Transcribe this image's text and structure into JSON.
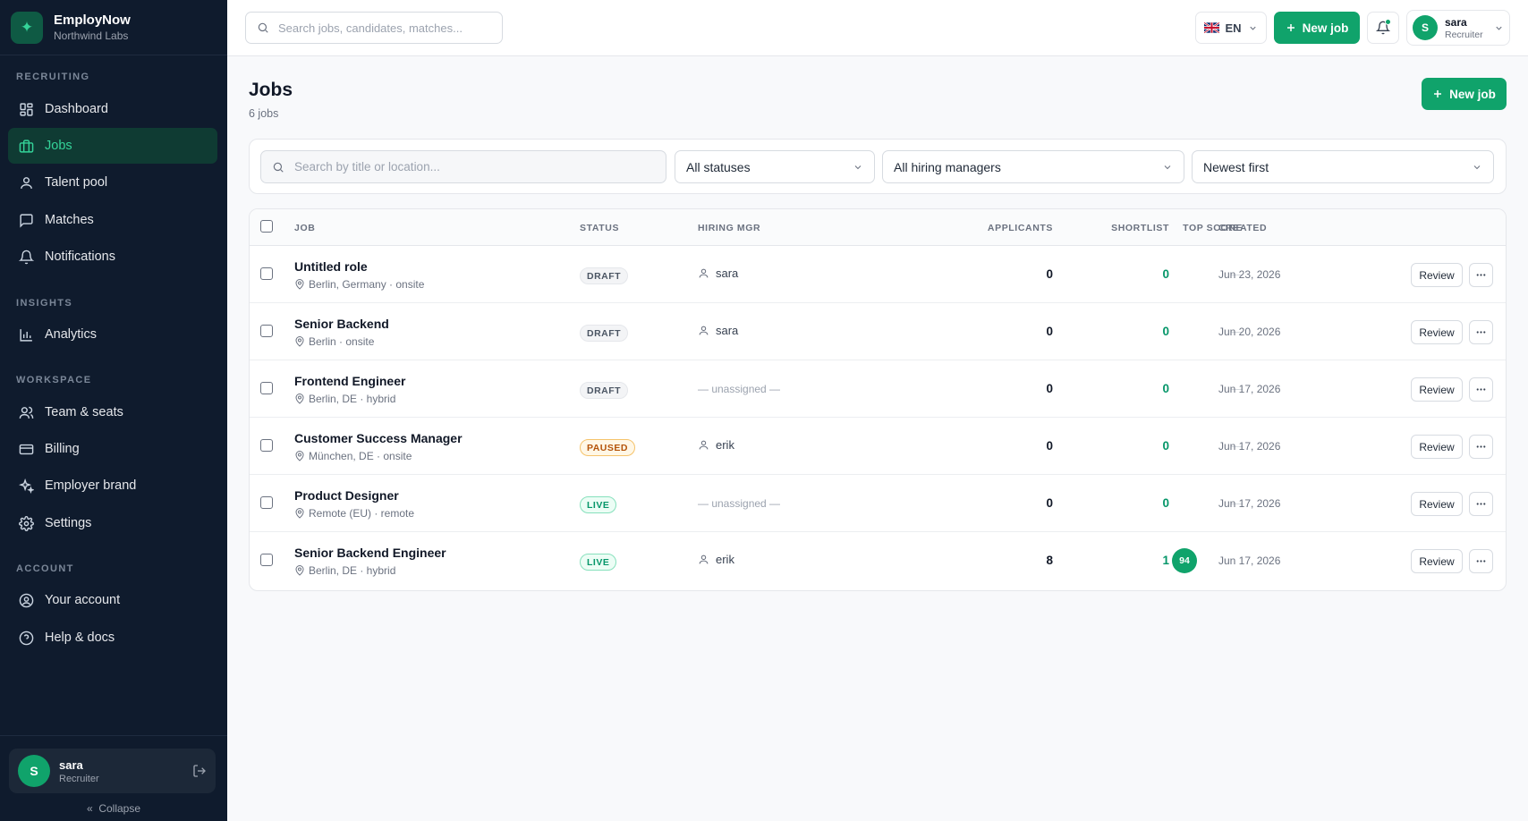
{
  "brand": {
    "name": "EmployNow",
    "org": "Northwind Labs",
    "logo_icon": "sparkle-icon",
    "accent": "#10a36b"
  },
  "sidebar": {
    "sections": [
      {
        "heading": "RECRUITING",
        "items": [
          {
            "label": "Dashboard",
            "icon": "dashboard-icon"
          },
          {
            "label": "Jobs",
            "icon": "briefcase-icon",
            "active": true
          },
          {
            "label": "Talent pool",
            "icon": "user-icon"
          },
          {
            "label": "Matches",
            "icon": "chat-icon"
          },
          {
            "label": "Notifications",
            "icon": "bell-icon"
          }
        ]
      },
      {
        "heading": "INSIGHTS",
        "items": [
          {
            "label": "Analytics",
            "icon": "bar-chart-icon"
          }
        ]
      },
      {
        "heading": "WORKSPACE",
        "items": [
          {
            "label": "Team & seats",
            "icon": "users-icon"
          },
          {
            "label": "Billing",
            "icon": "card-icon"
          },
          {
            "label": "Employer brand",
            "icon": "sparkles-icon"
          },
          {
            "label": "Settings",
            "icon": "gear-icon"
          }
        ]
      },
      {
        "heading": "ACCOUNT",
        "items": [
          {
            "label": "Your account",
            "icon": "user-circle-icon"
          },
          {
            "label": "Help & docs",
            "icon": "help-icon"
          }
        ]
      }
    ],
    "user": {
      "initial": "S",
      "name": "sara",
      "role": "Recruiter"
    },
    "collapse_label": "Collapse"
  },
  "topbar": {
    "search_placeholder": "Search jobs, candidates, matches...",
    "language": "EN",
    "new_job_label": "New job",
    "user": {
      "initial": "S",
      "name": "sara",
      "role": "Recruiter"
    }
  },
  "page": {
    "title": "Jobs",
    "count": "6 jobs",
    "new_job_label": "New job"
  },
  "filters": {
    "search_placeholder": "Search by title or location...",
    "status": "All statuses",
    "manager": "All hiring managers",
    "sort": "Newest first"
  },
  "table": {
    "columns": {
      "job": "JOB",
      "status": "STATUS",
      "manager": "HIRING MGR",
      "applicants": "APPLICANTS",
      "shortlist": "SHORTLIST",
      "top_score": "TOP SCORE",
      "created": "CREATED"
    },
    "review_label": "Review",
    "rows": [
      {
        "title": "Untitled role",
        "location": "Berlin, Germany · onsite",
        "status": "DRAFT",
        "status_kind": "draft",
        "manager": "sara",
        "applicants": "0",
        "shortlist": "0",
        "top_score": "—",
        "created": "Jun 23, 2026"
      },
      {
        "title": "Senior Backend",
        "location": "Berlin · onsite",
        "status": "DRAFT",
        "status_kind": "draft",
        "manager": "sara",
        "applicants": "0",
        "shortlist": "0",
        "top_score": "—",
        "created": "Jun 20, 2026"
      },
      {
        "title": "Frontend Engineer",
        "location": "Berlin, DE · hybrid",
        "status": "DRAFT",
        "status_kind": "draft",
        "manager": "— unassigned —",
        "unassigned": true,
        "applicants": "0",
        "shortlist": "0",
        "top_score": "—",
        "created": "Jun 17, 2026"
      },
      {
        "title": "Customer Success Manager",
        "location": "München, DE · onsite",
        "status": "PAUSED",
        "status_kind": "paused",
        "manager": "erik",
        "applicants": "0",
        "shortlist": "0",
        "top_score": "—",
        "created": "Jun 17, 2026"
      },
      {
        "title": "Product Designer",
        "location": "Remote (EU) · remote",
        "status": "LIVE",
        "status_kind": "live",
        "manager": "— unassigned —",
        "unassigned": true,
        "applicants": "0",
        "shortlist": "0",
        "top_score": "—",
        "created": "Jun 17, 2026"
      },
      {
        "title": "Senior Backend Engineer",
        "location": "Berlin, DE · hybrid",
        "status": "LIVE",
        "status_kind": "live",
        "manager": "erik",
        "applicants": "8",
        "shortlist": "1",
        "top_score": "94",
        "top_score_pill": true,
        "created": "Jun 17, 2026"
      }
    ]
  }
}
